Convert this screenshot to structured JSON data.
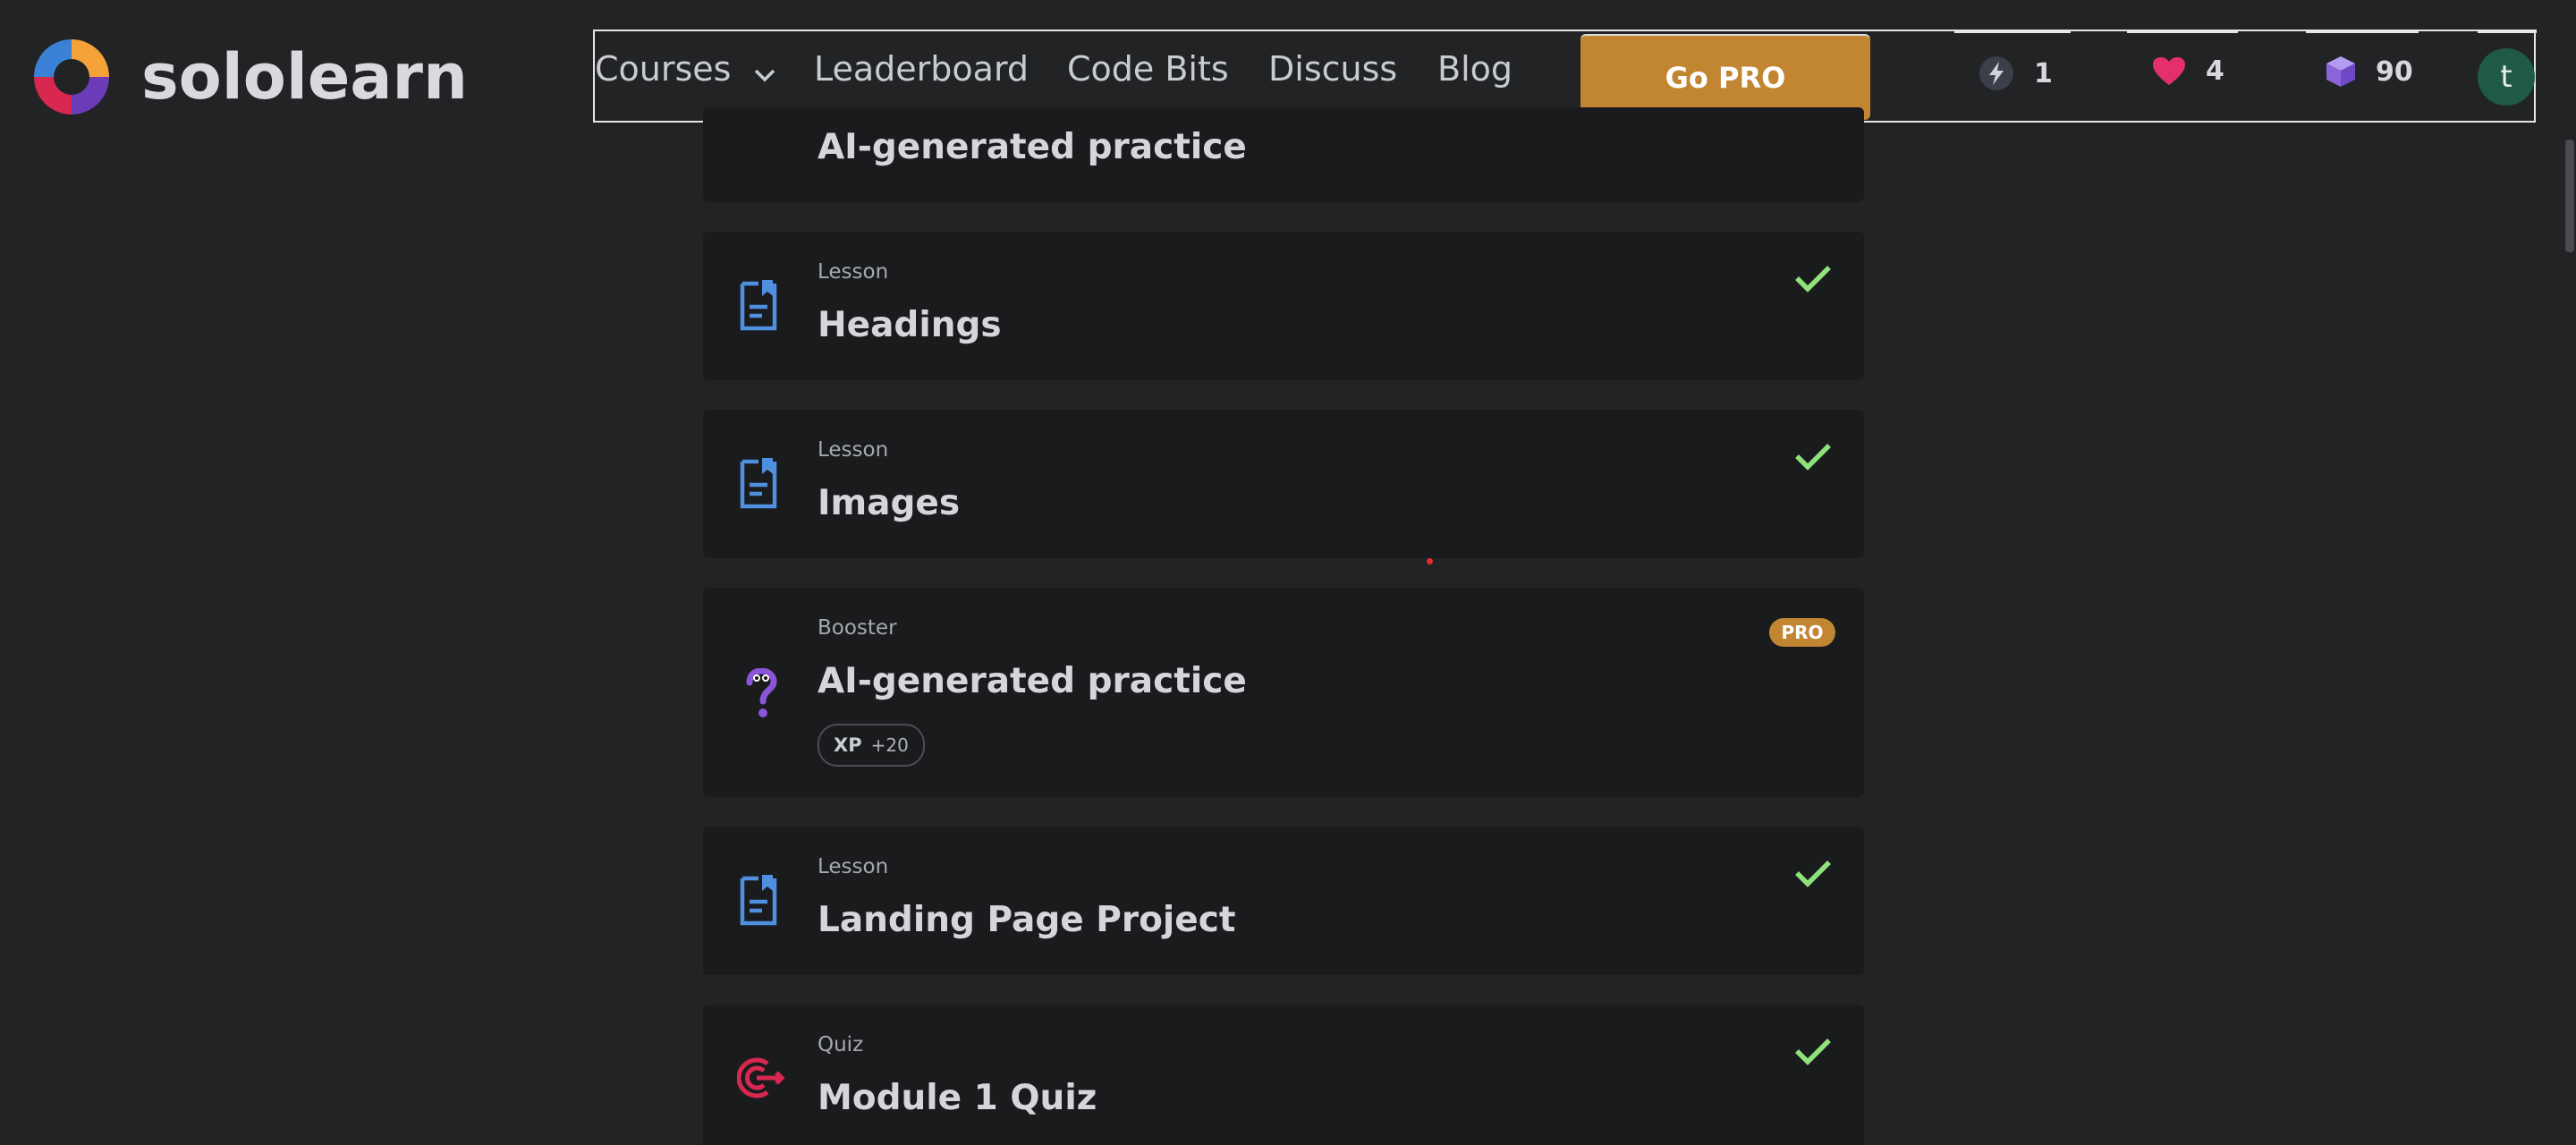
{
  "header": {
    "logo_text": "sololearn",
    "nav": {
      "courses": "Courses",
      "leaderboard": "Leaderboard",
      "code_bits": "Code Bits",
      "discuss": "Discuss",
      "blog": "Blog"
    },
    "go_pro": "Go PRO",
    "stats": {
      "streak": "1",
      "hearts": "4",
      "gems": "90"
    },
    "avatar_initial": "t"
  },
  "lesson_list": {
    "partial_top_title": "AI-generated practice",
    "items": [
      {
        "type": "Lesson",
        "title": "Headings",
        "completed": true,
        "icon": "lesson-icon"
      },
      {
        "type": "Lesson",
        "title": "Images",
        "completed": true,
        "icon": "lesson-icon"
      },
      {
        "type": "Booster",
        "title": "AI-generated practice",
        "badge": "PRO",
        "xp_label": "XP",
        "xp_value": "+20",
        "icon": "booster-question-icon"
      },
      {
        "type": "Lesson",
        "title": "Landing Page Project",
        "completed": true,
        "icon": "lesson-icon"
      },
      {
        "type": "Quiz",
        "title": "Module 1 Quiz",
        "completed": true,
        "icon": "quiz-target-icon"
      }
    ]
  },
  "colors": {
    "background": "#222325",
    "card": "#1a1b1d",
    "accent_pro": "#c28633",
    "check_green": "#8fe37a",
    "lesson_blue": "#4f8fe0",
    "quiz_red": "#d8284f",
    "booster_purple": "#8a55d8"
  }
}
